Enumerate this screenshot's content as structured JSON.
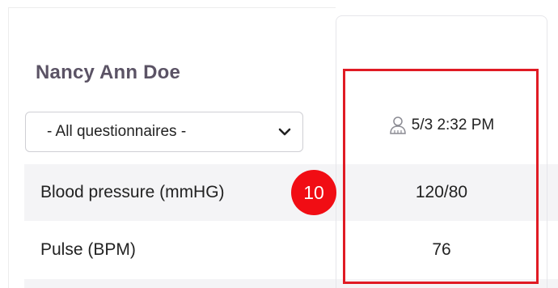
{
  "patient": {
    "name": "Nancy Ann Doe"
  },
  "filter": {
    "selected": "- All questionnaires -"
  },
  "column": {
    "datetime": "5/3 2:32 PM",
    "icon": "person-icon"
  },
  "rows": [
    {
      "label": "Blood pressure (mmHG)",
      "value": "120/80"
    },
    {
      "label": "Pulse (BPM)",
      "value": "76"
    }
  ],
  "annotation": {
    "step": "10",
    "badge_color": "#f10d14",
    "box_color": "#e01b24"
  },
  "colors": {
    "name_text": "#5b5365",
    "row_shade": "#f4f4f6"
  }
}
